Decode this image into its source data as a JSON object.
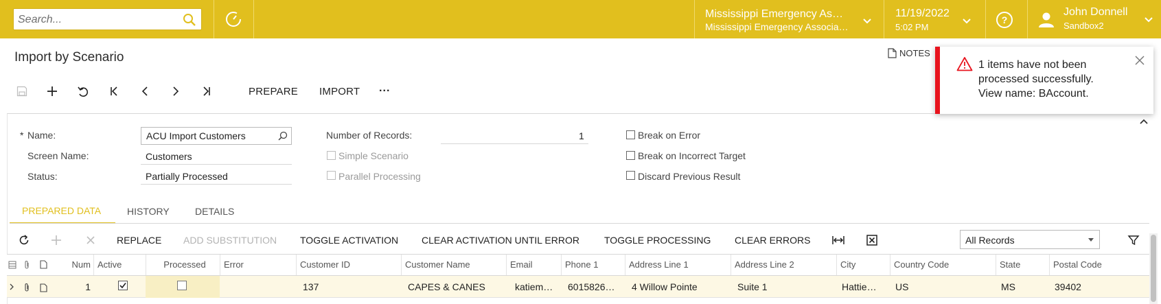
{
  "colors": {
    "accent": "#e1bf1e",
    "toast_bar": "#e8141e"
  },
  "topbar": {
    "search_placeholder": "Search...",
    "company": {
      "line1": "Mississippi Emergency As…",
      "line2": "Mississippi Emergency Associa…"
    },
    "date": "11/19/2022",
    "time": "5:02 PM",
    "user": {
      "name": "John Donnell",
      "tenant": "Sandbox2"
    },
    "icons": [
      "search-icon",
      "history-icon",
      "chevron-down-icon",
      "help-icon",
      "user-icon"
    ]
  },
  "page": {
    "title": "Import by Scenario",
    "notes_label": "NOTES"
  },
  "toolbar": {
    "prepare_label": "PREPARE",
    "import_label": "IMPORT",
    "more_label": "···",
    "icons": [
      "save-icon",
      "add-icon",
      "undo-icon",
      "first-icon",
      "prev-icon",
      "next-icon",
      "last-icon"
    ]
  },
  "toast": {
    "line1": "1 items have not been",
    "line2": "processed successfully.",
    "line3": "View name: BAccount."
  },
  "form": {
    "required_mark": "*",
    "name_label": "Name:",
    "name_value": "ACU Import Customers",
    "screen_label": "Screen Name:",
    "screen_value": "Customers",
    "status_label": "Status:",
    "status_value": "Partially Processed",
    "records_label": "Number of Records:",
    "records_value": "1",
    "simple_label": "Simple Scenario",
    "parallel_label": "Parallel Processing",
    "break_error_label": "Break on Error",
    "break_target_label": "Break on Incorrect Target",
    "discard_label": "Discard Previous Result"
  },
  "tabs": [
    {
      "label": "PREPARED DATA",
      "active": true
    },
    {
      "label": "HISTORY",
      "active": false
    },
    {
      "label": "DETAILS",
      "active": false
    }
  ],
  "grid_toolbar": {
    "replace": "REPLACE",
    "add_substitution": "ADD SUBSTITUTION",
    "toggle_activation": "TOGGLE ACTIVATION",
    "clear_activation": "CLEAR ACTIVATION UNTIL ERROR",
    "toggle_processing": "TOGGLE PROCESSING",
    "clear_errors": "CLEAR ERRORS",
    "filter_value": "All Records"
  },
  "grid": {
    "columns": [
      "Num",
      "Active",
      "Processed",
      "Error",
      "Customer ID",
      "Customer Name",
      "Email",
      "Phone 1",
      "Address Line 1",
      "Address Line 2",
      "City",
      "Country Code",
      "State",
      "Postal Code"
    ],
    "rows": [
      {
        "num": "1",
        "active": true,
        "processed": false,
        "error": "",
        "customer_id": "137",
        "customer_name": "CAPES & CANES",
        "email": "katiem…",
        "phone": "6015826…",
        "address1": "4 Willow Pointe",
        "address2": "Suite 1",
        "city": "Hattie…",
        "country": "US",
        "state": "MS",
        "postal": "39402"
      }
    ]
  }
}
